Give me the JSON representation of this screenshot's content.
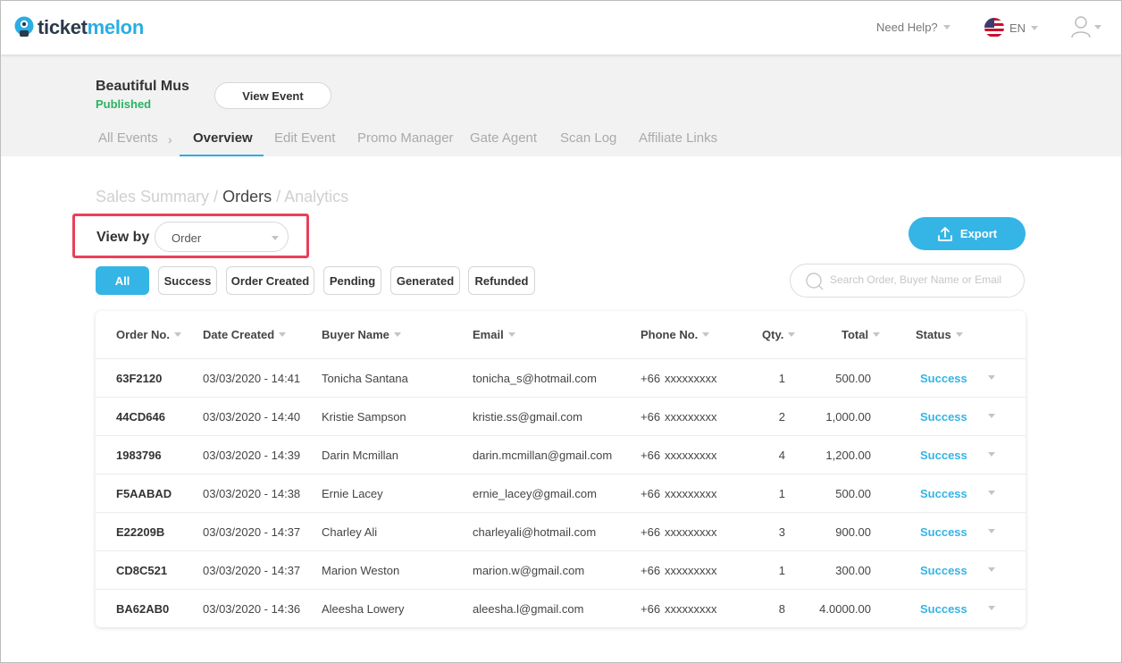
{
  "brand": {
    "part1": "ticket",
    "part2": "melon"
  },
  "header": {
    "help_label": "Need Help?",
    "language": "EN"
  },
  "event": {
    "name": "Beautiful Mus",
    "status": "Published",
    "view_button": "View Event"
  },
  "nav": {
    "items": [
      "All Events",
      "Overview",
      "Edit Event",
      "Promo Manager",
      "Gate Agent",
      "Scan Log",
      "Affiliate Links"
    ],
    "active": "Overview"
  },
  "breadcrumb": {
    "first": "Sales Summary",
    "sep": "/",
    "current": "Orders",
    "last": "Analytics"
  },
  "view_by": {
    "label": "View by",
    "value": "Order"
  },
  "export_label": "Export",
  "filters": [
    "All",
    "Success",
    "Order Created",
    "Pending",
    "Generated",
    "Refunded"
  ],
  "search": {
    "placeholder": "Search Order, Buyer Name or Email"
  },
  "table": {
    "columns": [
      "Order No.",
      "Date Created",
      "Buyer Name",
      "Email",
      "Phone No.",
      "Qty.",
      "Total",
      "Status"
    ],
    "rows": [
      {
        "order": "63F2120",
        "date": "03/03/2020 - 14:41",
        "buyer": "Tonicha Santana",
        "email": "tonicha_s@hotmail.com",
        "phone_code": "+66",
        "phone": "xxxxxxxxx",
        "qty": "1",
        "total": "500.00",
        "status": "Success"
      },
      {
        "order": "44CD646",
        "date": "03/03/2020 - 14:40",
        "buyer": "Kristie Sampson",
        "email": "kristie.ss@gmail.com",
        "phone_code": "+66",
        "phone": "xxxxxxxxx",
        "qty": "2",
        "total": "1,000.00",
        "status": "Success"
      },
      {
        "order": "1983796",
        "date": "03/03/2020 - 14:39",
        "buyer": "Darin Mcmillan",
        "email": "darin.mcmillan@gmail.com",
        "phone_code": "+66",
        "phone": "xxxxxxxxx",
        "qty": "4",
        "total": "1,200.00",
        "status": "Success"
      },
      {
        "order": "F5AABAD",
        "date": "03/03/2020 - 14:38",
        "buyer": "Ernie Lacey",
        "email": "ernie_lacey@gmail.com",
        "phone_code": "+66",
        "phone": "xxxxxxxxx",
        "qty": "1",
        "total": "500.00",
        "status": "Success"
      },
      {
        "order": "E22209B",
        "date": "03/03/2020 - 14:37",
        "buyer": "Charley Ali",
        "email": "charleyali@hotmail.com",
        "phone_code": "+66",
        "phone": "xxxxxxxxx",
        "qty": "3",
        "total": "900.00",
        "status": "Success"
      },
      {
        "order": "CD8C521",
        "date": "03/03/2020 - 14:37",
        "buyer": "Marion Weston",
        "email": "marion.w@gmail.com",
        "phone_code": "+66",
        "phone": "xxxxxxxxx",
        "qty": "1",
        "total": "300.00",
        "status": "Success"
      },
      {
        "order": "BA62AB0",
        "date": "03/03/2020 - 14:36",
        "buyer": "Aleesha Lowery",
        "email": "aleesha.l@gmail.com",
        "phone_code": "+66",
        "phone": "xxxxxxxxx",
        "qty": "8",
        "total": "4.0000.00",
        "status": "Success"
      }
    ]
  },
  "colors": {
    "accent": "#35b4e6",
    "published": "#28b463",
    "highlight": "#e8405a"
  }
}
